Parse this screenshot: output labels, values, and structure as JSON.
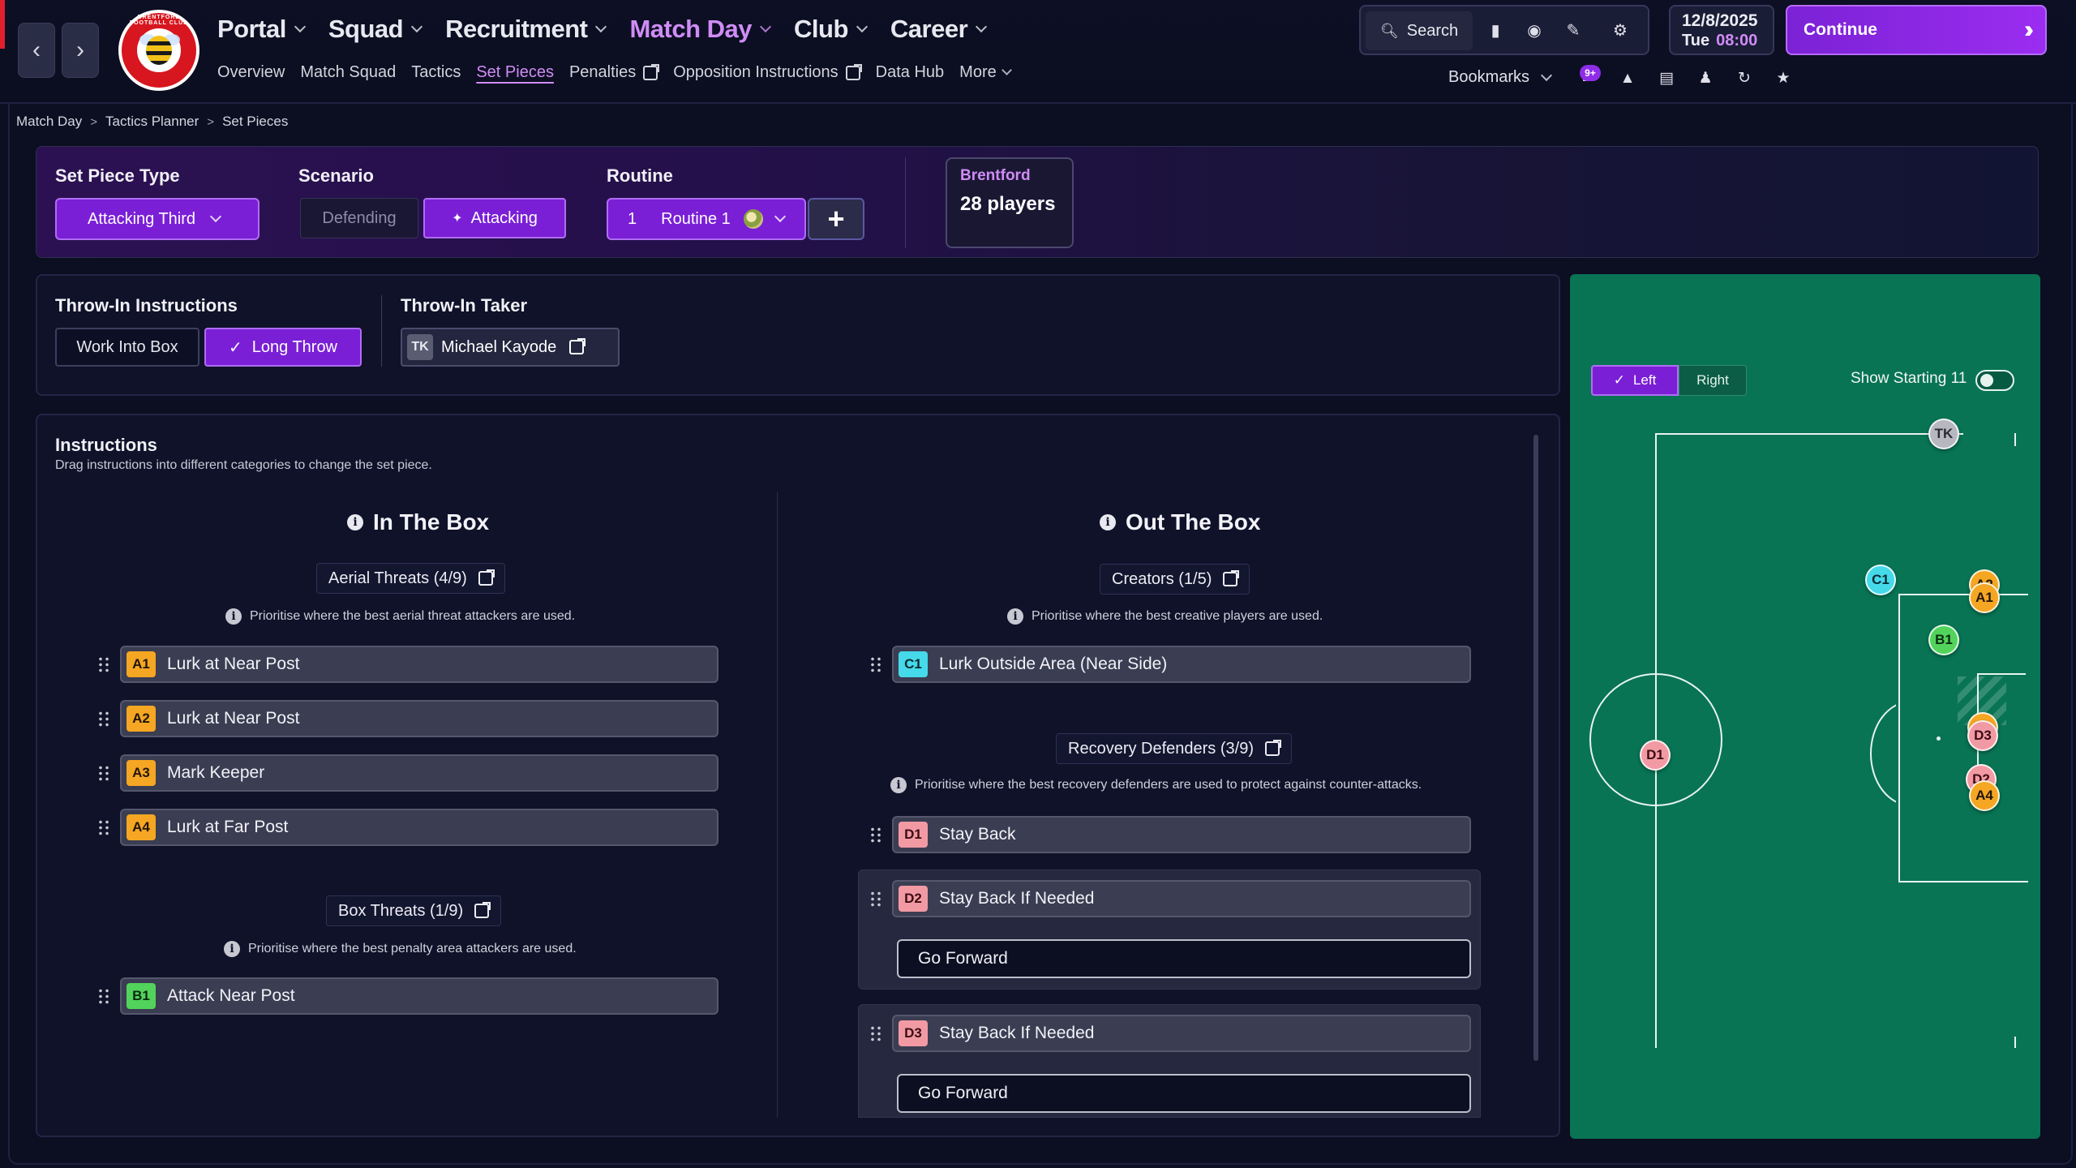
{
  "header": {
    "main_nav": [
      {
        "label": "Portal",
        "active": false
      },
      {
        "label": "Squad",
        "active": false
      },
      {
        "label": "Recruitment",
        "active": false
      },
      {
        "label": "Match Day",
        "active": true
      },
      {
        "label": "Club",
        "active": false
      },
      {
        "label": "Career",
        "active": false
      }
    ],
    "sub_nav": [
      {
        "label": "Overview"
      },
      {
        "label": "Match Squad"
      },
      {
        "label": "Tactics"
      },
      {
        "label": "Set Pieces",
        "active": true
      },
      {
        "label": "Penalties",
        "external": true
      },
      {
        "label": "Opposition Instructions",
        "external": true
      },
      {
        "label": "Data Hub"
      },
      {
        "label": "More"
      }
    ],
    "crest_text": "BRENTFORD FOOTBALL CLUB",
    "search_label": "Search",
    "date": "12/8/2025",
    "day": "Tue",
    "time": "08:00",
    "continue_label": "Continue",
    "bookmarks_label": "Bookmarks",
    "notification_badge": "9+"
  },
  "breadcrumb": [
    "Match Day",
    "Tactics Planner",
    "Set Pieces"
  ],
  "setup": {
    "set_piece_type_label": "Set Piece Type",
    "set_piece_type_value": "Attacking Third",
    "scenario_label": "Scenario",
    "scenario_options": [
      "Defending",
      "Attacking"
    ],
    "scenario_selected": "Attacking",
    "routine_label": "Routine",
    "routine_number": "1",
    "routine_value": "Routine 1",
    "team_name": "Brentford",
    "team_players": "28 players"
  },
  "throw_in": {
    "instructions_label": "Throw-In Instructions",
    "options": [
      "Work Into Box",
      "Long Throw"
    ],
    "selected": "Long Throw",
    "taker_label": "Throw-In Taker",
    "taker_chip": "TK",
    "taker_name": "Michael Kayode"
  },
  "instructions": {
    "title": "Instructions",
    "subtitle": "Drag instructions into different categories to change the set piece.",
    "in_box": {
      "heading": "In The Box",
      "aerial": {
        "label": "Aerial Threats (4/9)",
        "hint": "Prioritise where the best aerial threat attackers are used.",
        "rows": [
          {
            "code": "A1",
            "text": "Lurk at Near Post"
          },
          {
            "code": "A2",
            "text": "Lurk at Near Post"
          },
          {
            "code": "A3",
            "text": "Mark Keeper"
          },
          {
            "code": "A4",
            "text": "Lurk at Far Post"
          }
        ]
      },
      "box": {
        "label": "Box Threats (1/9)",
        "hint": "Prioritise where the best penalty area attackers are used.",
        "rows": [
          {
            "code": "B1",
            "text": "Attack Near Post"
          }
        ]
      }
    },
    "out_box": {
      "heading": "Out The Box",
      "creators": {
        "label": "Creators (1/5)",
        "hint": "Prioritise where the best creative players are used.",
        "rows": [
          {
            "code": "C1",
            "text": "Lurk Outside Area (Near Side)"
          }
        ]
      },
      "recovery": {
        "label": "Recovery Defenders (3/9)",
        "hint": "Prioritise where the best recovery defenders are used to protect against counter-attacks.",
        "rows": [
          {
            "code": "D1",
            "text": "Stay Back"
          },
          {
            "code": "D2",
            "text": "Stay Back If Needed",
            "sub": "Go Forward"
          },
          {
            "code": "D3",
            "text": "Stay Back If Needed",
            "sub": "Go Forward"
          }
        ]
      }
    }
  },
  "pitch": {
    "side_options": [
      "Left",
      "Right"
    ],
    "side_selected": "Left",
    "show_starting_label": "Show Starting 11",
    "show_starting_on": false,
    "tokens": [
      "TK",
      "C1",
      "A2",
      "A1",
      "B1",
      "A3",
      "D3",
      "D1",
      "D2",
      "A4"
    ]
  },
  "colors": {
    "accent": "#7a1fd6",
    "accent_text": "#d08cf5",
    "pitch": "#087454",
    "chip_attack": "#f5a623",
    "chip_box": "#52d35c",
    "chip_creator": "#45d9ea",
    "chip_defender": "#f29aa4"
  }
}
